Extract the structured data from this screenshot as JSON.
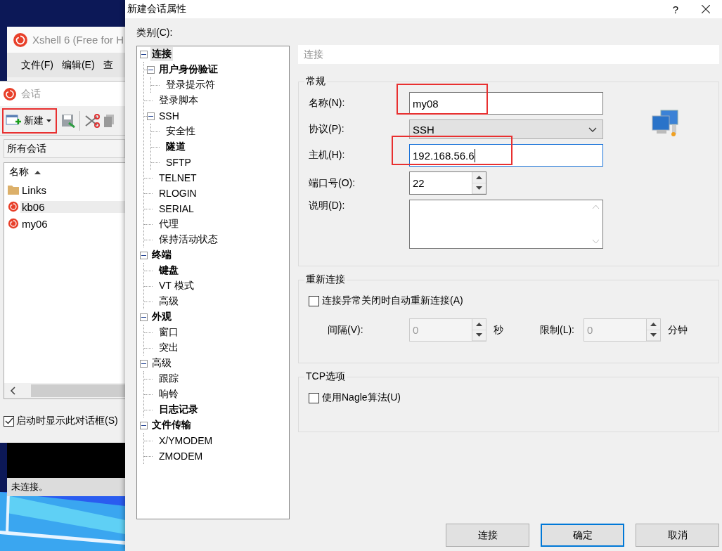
{
  "background_window": {
    "title": "Xshell 6 (Free for H",
    "menu": [
      "文件(F)",
      "编辑(E)",
      "查"
    ],
    "status": "未连接。"
  },
  "sessions_dialog": {
    "title": "会话",
    "new_label": "新建",
    "new_highlighted": true,
    "folder": "所有会话",
    "column": "名称",
    "items": [
      {
        "name": "Links",
        "kind": "folder",
        "selected": false
      },
      {
        "name": "kb06",
        "kind": "session",
        "selected": true
      },
      {
        "name": "my06",
        "kind": "session",
        "selected": false
      }
    ],
    "show_on_startup": {
      "label": "启动时显示此对话框(S)",
      "checked": true
    }
  },
  "dialog": {
    "title": "新建会话属性",
    "help": "?",
    "category_label": "类别(C):",
    "tree": [
      {
        "label": "连接",
        "bold": true,
        "selected": true,
        "expanded": true,
        "children": [
          {
            "label": "用户身份验证",
            "bold": true,
            "selected": false,
            "expanded": true,
            "children": [
              {
                "label": "登录提示符",
                "bold": false,
                "selected": false
              }
            ]
          },
          {
            "label": "登录脚本",
            "bold": false,
            "selected": false
          },
          {
            "label": "SSH",
            "bold": false,
            "selected": false,
            "expanded": true,
            "children": [
              {
                "label": "安全性",
                "bold": false,
                "selected": false
              },
              {
                "label": "隧道",
                "bold": true,
                "selected": false
              },
              {
                "label": "SFTP",
                "bold": false,
                "selected": false
              }
            ]
          },
          {
            "label": "TELNET",
            "bold": false,
            "selected": false
          },
          {
            "label": "RLOGIN",
            "bold": false,
            "selected": false
          },
          {
            "label": "SERIAL",
            "bold": false,
            "selected": false
          },
          {
            "label": "代理",
            "bold": false,
            "selected": false
          },
          {
            "label": "保持活动状态",
            "bold": false,
            "selected": false
          }
        ]
      },
      {
        "label": "终端",
        "bold": true,
        "selected": false,
        "expanded": true,
        "children": [
          {
            "label": "键盘",
            "bold": true,
            "selected": false
          },
          {
            "label": "VT 模式",
            "bold": false,
            "selected": false
          },
          {
            "label": "高级",
            "bold": false,
            "selected": false
          }
        ]
      },
      {
        "label": "外观",
        "bold": true,
        "selected": false,
        "expanded": true,
        "children": [
          {
            "label": "窗口",
            "bold": false,
            "selected": false
          },
          {
            "label": "突出",
            "bold": false,
            "selected": false
          }
        ]
      },
      {
        "label": "高级",
        "bold": false,
        "selected": false,
        "expanded": true,
        "children": [
          {
            "label": "跟踪",
            "bold": false,
            "selected": false
          },
          {
            "label": "响铃",
            "bold": false,
            "selected": false
          },
          {
            "label": "日志记录",
            "bold": true,
            "selected": false
          }
        ]
      },
      {
        "label": "文件传输",
        "bold": true,
        "selected": false,
        "expanded": true,
        "children": [
          {
            "label": "X/YMODEM",
            "bold": false,
            "selected": false
          },
          {
            "label": "ZMODEM",
            "bold": false,
            "selected": false
          }
        ]
      }
    ],
    "panel_title": "连接",
    "general": {
      "legend": "常规",
      "fields": [
        {
          "kind": "text",
          "label": "名称(N):",
          "value": "my08",
          "highlighted": true,
          "focused": false
        },
        {
          "kind": "select",
          "label": "协议(P):",
          "value": "SSH"
        },
        {
          "kind": "text",
          "label": "主机(H):",
          "value": "192.168.56.6",
          "highlighted": true,
          "focused": true
        },
        {
          "kind": "spin",
          "label": "端口号(O):",
          "value": "22"
        },
        {
          "kind": "memo",
          "label": "说明(D):"
        }
      ]
    },
    "reconnect": {
      "legend": "重新连接",
      "checkbox": {
        "label": "连接异常关闭时自动重新连接(A)",
        "checked": false
      },
      "spins": [
        {
          "label": "间隔(V):",
          "value": "0",
          "unit": "秒",
          "disabled": true
        },
        {
          "label": "限制(L):",
          "value": "0",
          "unit": "分钟",
          "disabled": true
        }
      ]
    },
    "tcp": {
      "legend": "TCP选项",
      "checkbox": {
        "label": "使用Nagle算法(U)",
        "checked": false
      }
    },
    "buttons": [
      {
        "label": "连接",
        "default": false
      },
      {
        "label": "确定",
        "default": true
      },
      {
        "label": "取消",
        "default": false
      }
    ]
  }
}
